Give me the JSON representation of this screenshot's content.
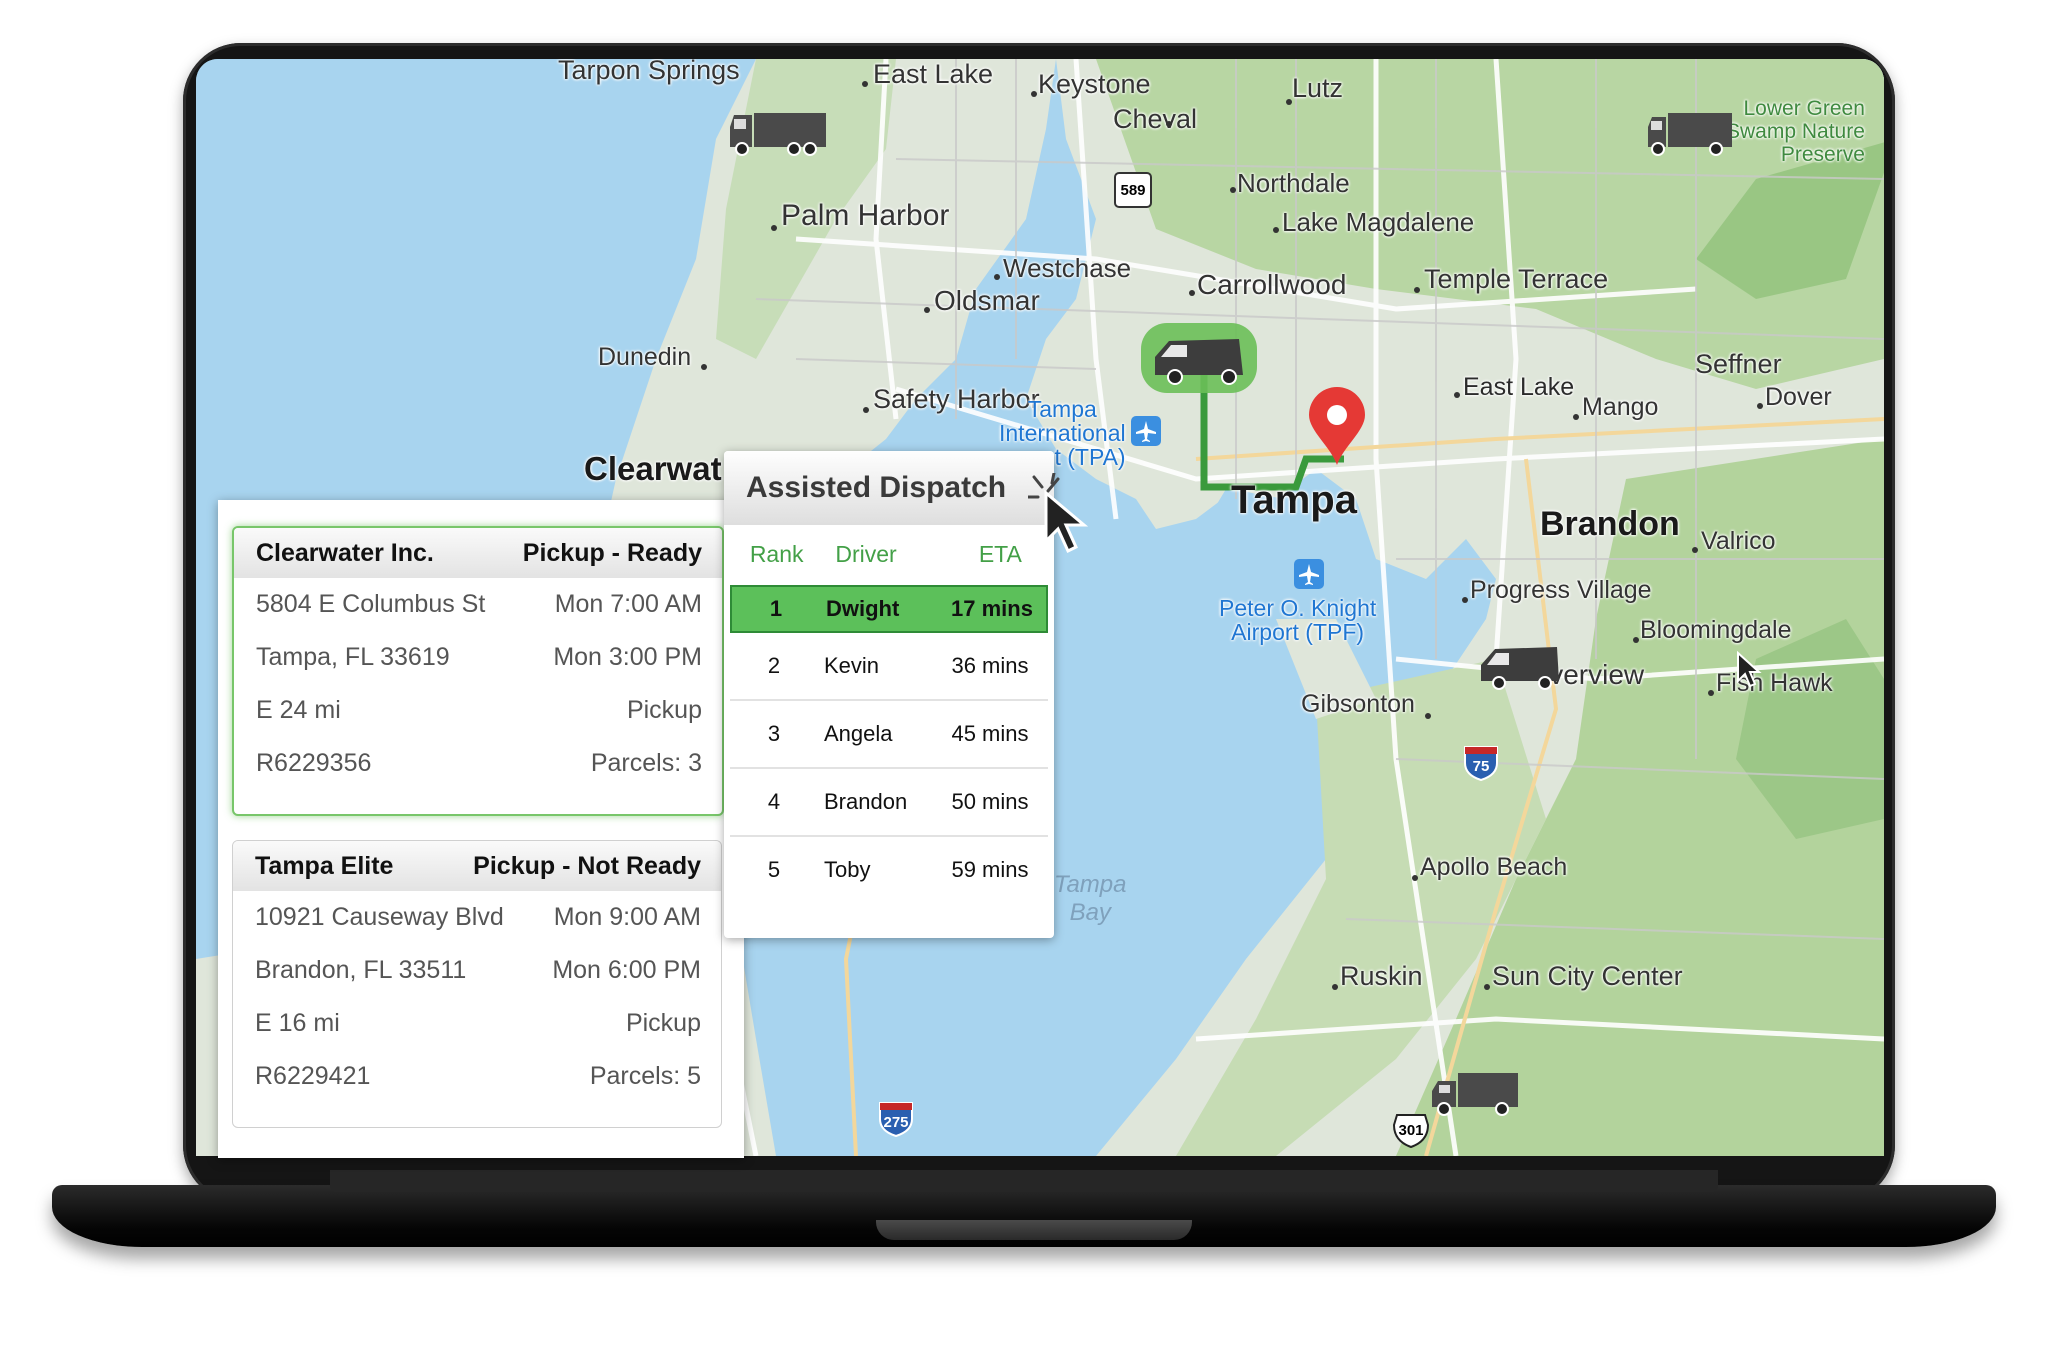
{
  "map": {
    "places": {
      "tarpon_springs": "Tarpon Springs",
      "east_lake_n": "East Lake",
      "keystone": "Keystone",
      "lutz": "Lutz",
      "cheval": "Cheval",
      "palm_harbor": "Palm Harbor",
      "northdale": "Northdale",
      "lake_magdalene": "Lake Magdalene",
      "westchase": "Westchase",
      "carrollwood": "Carrollwood",
      "temple_terrace": "Temple Terrace",
      "oldsmar": "Oldsmar",
      "dunedin": "Dunedin",
      "seffner": "Seffner",
      "east_lake_e": "East Lake",
      "mango": "Mango",
      "dover": "Dover",
      "safety_harbor": "Safety Harbor",
      "clearwater": "Clearwat",
      "tampa": "Tampa",
      "brandon": "Brandon",
      "valrico": "Valrico",
      "progress_village": "Progress Village",
      "bloomingdale": "Bloomingdale",
      "riverview": "iverview",
      "fish_hawk": "Fish Hawk",
      "gibsonton": "Gibsonton",
      "apollo_beach": "Apollo Beach",
      "ruskin": "Ruskin",
      "sun_city_center": "Sun City Center"
    },
    "pois": {
      "tampa_airport_line1": "Tampa",
      "tampa_airport_line2": "International",
      "tampa_airport_line3": "t (TPA)",
      "knight_airport_line1": "Peter O. Knight",
      "knight_airport_line2": "Airport (TPF)",
      "park_line1": "Lower Green",
      "park_line2": "Swamp Nature",
      "park_line3": "Preserve",
      "bay_line1": "Tampa",
      "bay_line2": "Bay"
    },
    "shields": {
      "r589": "589",
      "i75": "75",
      "i275": "275",
      "us301": "301"
    },
    "colors": {
      "water": "#a8d4ef",
      "land_green": "#a9cf94",
      "land_light": "#dfe6da",
      "route": "#3a9a3c",
      "pin": "#e53935"
    }
  },
  "pickups": [
    {
      "company": "Clearwater Inc.",
      "status": "Pickup - Ready",
      "address": "5804 E Columbus St",
      "city": "Tampa, FL 33619",
      "window_start": "Mon 7:00 AM",
      "window_end": "Mon 3:00 PM",
      "distance": "E 24 mi",
      "type": "Pickup",
      "ref": "R6229356",
      "parcels": "Parcels: 3"
    },
    {
      "company": "Tampa Elite",
      "status": "Pickup - Not Ready",
      "address": "10921 Causeway Blvd",
      "city": "Brandon, FL 33511",
      "window_start": "Mon 9:00 AM",
      "window_end": "Mon 6:00 PM",
      "distance": "E 16 mi",
      "type": "Pickup",
      "ref": "R6229421",
      "parcels": "Parcels: 5"
    }
  ],
  "dispatch": {
    "title": "Assisted Dispatch",
    "columns": {
      "rank": "Rank",
      "driver": "Driver",
      "eta": "ETA"
    },
    "rows": [
      {
        "rank": "1",
        "driver": "Dwight",
        "eta": "17 mins"
      },
      {
        "rank": "2",
        "driver": "Kevin",
        "eta": "36 mins"
      },
      {
        "rank": "3",
        "driver": "Angela",
        "eta": "45 mins"
      },
      {
        "rank": "4",
        "driver": "Brandon",
        "eta": "50 mins"
      },
      {
        "rank": "5",
        "driver": "Toby",
        "eta": "59 mins"
      }
    ],
    "selected_color": "#5cc05a"
  }
}
